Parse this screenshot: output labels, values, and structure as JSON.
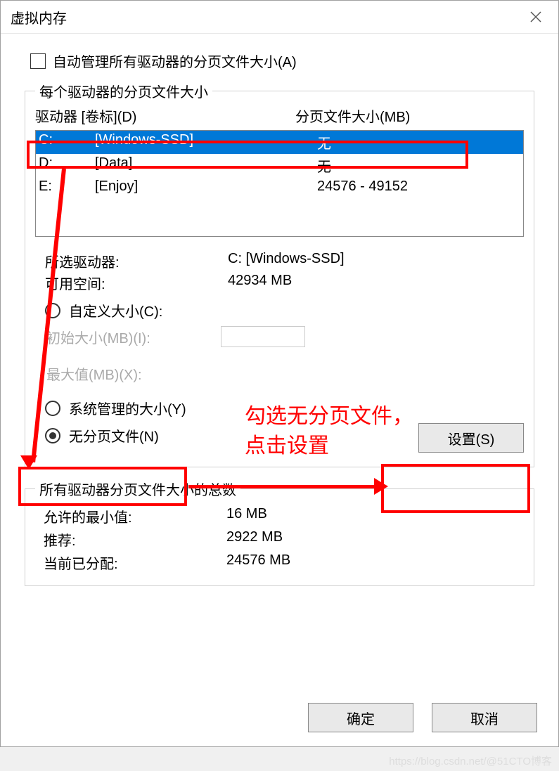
{
  "title": "虚拟内存",
  "auto_manage": "自动管理所有驱动器的分页文件大小(A)",
  "group1": {
    "legend": "每个驱动器的分页文件大小",
    "header_drive": "驱动器 [卷标](D)",
    "header_size": "分页文件大小(MB)",
    "rows": [
      {
        "drive": "C:",
        "volume": "[Windows-SSD]",
        "size": "无"
      },
      {
        "drive": "D:",
        "volume": "[Data]",
        "size": "无"
      },
      {
        "drive": "E:",
        "volume": "[Enjoy]",
        "size": "24576 - 49152"
      }
    ],
    "selected_label": "所选驱动器:",
    "selected_value": "C:  [Windows-SSD]",
    "space_label": "可用空间:",
    "space_value": "42934 MB",
    "custom_label": "自定义大小(C):",
    "initial_label": "初始大小(MB)(I):",
    "max_label": "最大值(MB)(X):",
    "system_label": "系统管理的大小(Y)",
    "none_label": "无分页文件(N)",
    "set_btn": "设置(S)"
  },
  "group2": {
    "legend": "所有驱动器分页文件大小的总数",
    "min_label": "允许的最小值:",
    "min_value": "16 MB",
    "rec_label": "推荐:",
    "rec_value": "2922 MB",
    "cur_label": "当前已分配:",
    "cur_value": "24576 MB"
  },
  "ok_btn": "确定",
  "cancel_btn": "取消",
  "annotation": "勾选无分页文件，\n点击设置",
  "watermark": "https://blog.csdn.net/@51CTO博客"
}
